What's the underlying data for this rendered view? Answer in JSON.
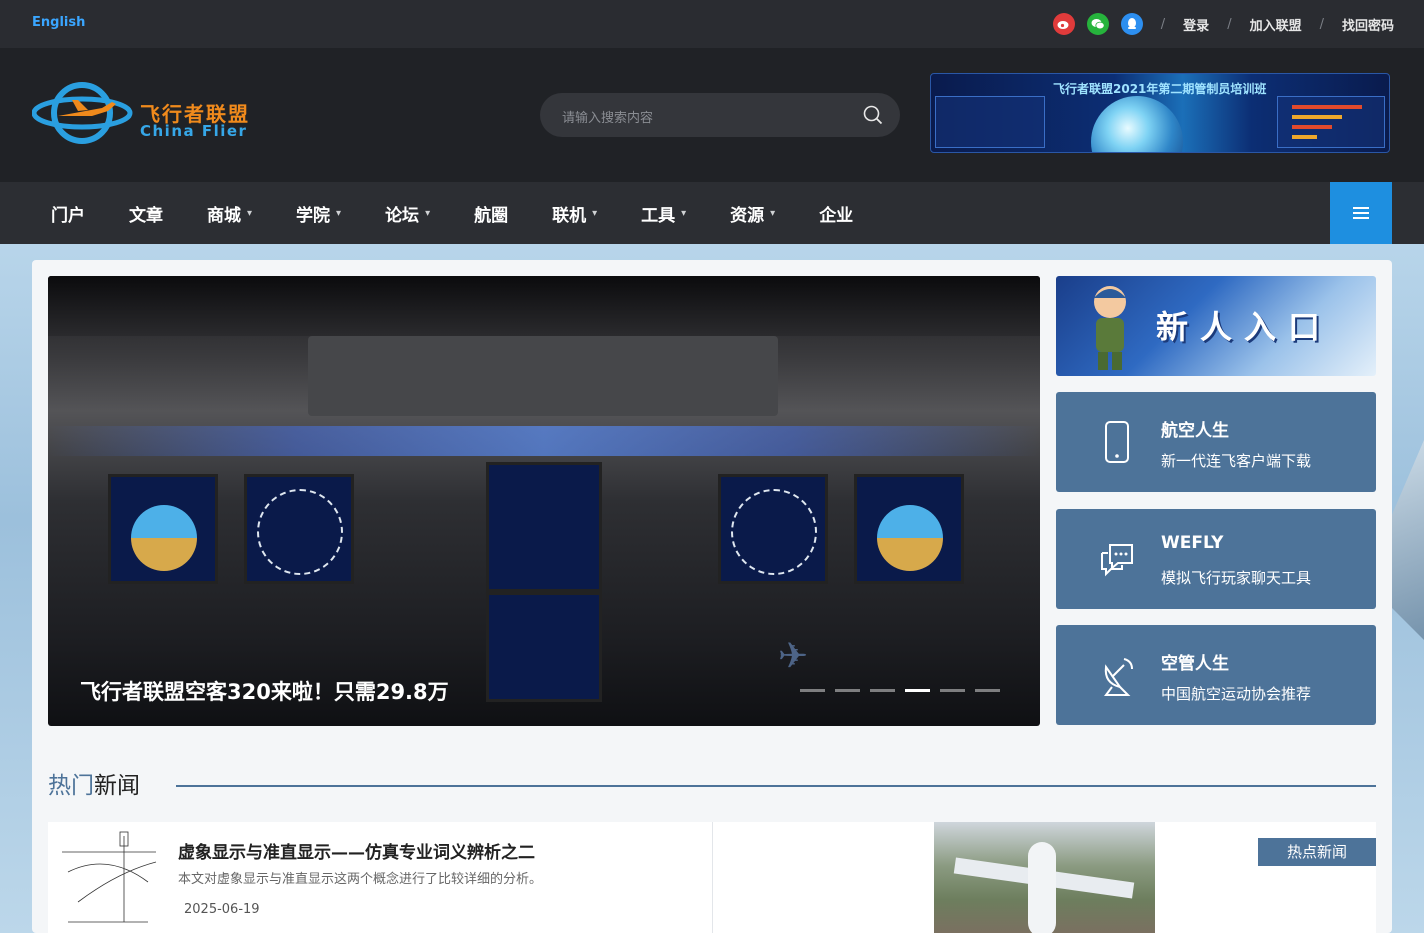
{
  "topbar": {
    "language": "English",
    "social_icons": [
      "weibo-icon",
      "wechat-icon",
      "qq-icon"
    ],
    "links": [
      "登录",
      "加入联盟",
      "找回密码"
    ]
  },
  "header": {
    "logo_cn": "飞行者联盟",
    "logo_en": "China Flier",
    "search_placeholder": "请输入搜索内容",
    "banner_title": "飞行者联盟2021年第二期管制员培训班"
  },
  "nav": {
    "items": [
      {
        "label": "门户",
        "dropdown": false
      },
      {
        "label": "文章",
        "dropdown": false
      },
      {
        "label": "商城",
        "dropdown": true
      },
      {
        "label": "学院",
        "dropdown": true
      },
      {
        "label": "论坛",
        "dropdown": true
      },
      {
        "label": "航圈",
        "dropdown": false
      },
      {
        "label": "联机",
        "dropdown": true
      },
      {
        "label": "工具",
        "dropdown": true
      },
      {
        "label": "资源",
        "dropdown": true
      },
      {
        "label": "企业",
        "dropdown": false
      }
    ],
    "caret": "⌄"
  },
  "carousel": {
    "caption": "飞行者联盟空客320来啦！只需29.8万",
    "slide_count": 6,
    "active_slide": 4
  },
  "sidebar": {
    "newbie_label": "新人入口",
    "cards": [
      {
        "title": "航空人生",
        "subtitle": "新一代连飞客户端下载",
        "icon": "phone-icon"
      },
      {
        "title": "WEFLY",
        "subtitle": "模拟飞行玩家聊天工具",
        "icon": "chat-icon"
      },
      {
        "title": "空管人生",
        "subtitle": "中国航空运动协会推荐",
        "icon": "radar-dish-icon"
      }
    ]
  },
  "hot_news": {
    "heading_highlight": "热门",
    "heading_rest": "新闻",
    "items": [
      {
        "title": "虚象显示与准直显示——仿真专业词义辨析之二",
        "desc": "本文对虚象显示与准直显示这两个概念进行了比较详细的分析。",
        "date": "2025-06-19"
      }
    ],
    "badge": "热点新闻"
  },
  "colors": {
    "accent_blue": "#1e8fe0",
    "card_blue": "#4d7399",
    "logo_orange": "#f08a1c"
  }
}
